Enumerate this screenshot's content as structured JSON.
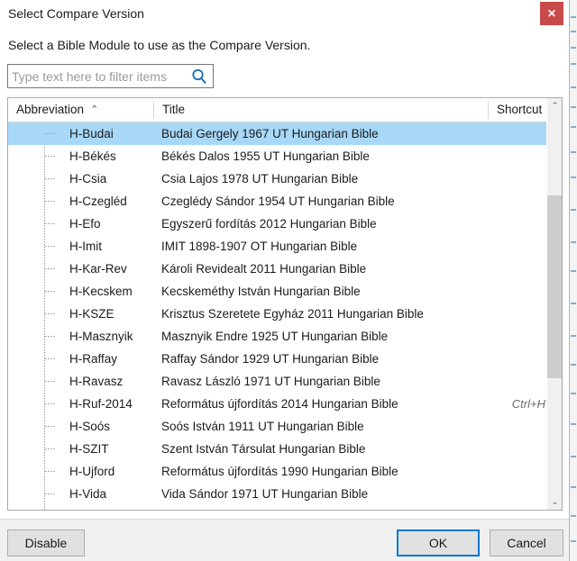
{
  "dialog": {
    "title": "Select Compare Version",
    "instruction": "Select a Bible Module to use as the Compare Version.",
    "close_label": "✕",
    "accent_close_color": "#c84a4a",
    "selection_color": "#a8d8f8",
    "focus_color": "#0078d7"
  },
  "filter": {
    "value": "",
    "placeholder": "Type text here to filter items",
    "icon": "search-icon"
  },
  "list": {
    "columns": [
      {
        "key": "abbreviation",
        "label": "Abbreviation",
        "sort": "ascending",
        "sort_caret": "⌃"
      },
      {
        "key": "title",
        "label": "Title",
        "sort": "none"
      },
      {
        "key": "shortcut",
        "label": "Shortcut",
        "sort": "none"
      }
    ],
    "rows": [
      {
        "abbreviation": "H-Budai",
        "title": "Budai Gergely 1967 UT Hungarian Bible",
        "shortcut": "",
        "selected": true
      },
      {
        "abbreviation": "H-Békés",
        "title": "Békés Dalos 1955 UT Hungarian Bible",
        "shortcut": "",
        "selected": false
      },
      {
        "abbreviation": "H-Csia",
        "title": "Csia Lajos 1978 UT Hungarian Bible",
        "shortcut": "",
        "selected": false
      },
      {
        "abbreviation": "H-Czegléd",
        "title": "Czeglédy Sándor 1954 UT Hungarian Bible",
        "shortcut": "",
        "selected": false
      },
      {
        "abbreviation": "H-Efo",
        "title": "Egyszerű fordítás 2012 Hungarian Bible",
        "shortcut": "",
        "selected": false
      },
      {
        "abbreviation": "H-Imit",
        "title": "IMIT 1898-1907 OT Hungarian Bible",
        "shortcut": "",
        "selected": false
      },
      {
        "abbreviation": "H-Kar-Rev",
        "title": "Károli Revidealt 2011 Hungarian Bible",
        "shortcut": "",
        "selected": false
      },
      {
        "abbreviation": "H-Kecskem",
        "title": "Kecskeméthy István Hungarian Bible",
        "shortcut": "",
        "selected": false
      },
      {
        "abbreviation": "H-KSZE",
        "title": "Krisztus Szeretete Egyház 2011 Hungarian Bible",
        "shortcut": "",
        "selected": false
      },
      {
        "abbreviation": "H-Masznyik",
        "title": "Masznyik Endre 1925 UT Hungarian Bible",
        "shortcut": "",
        "selected": false
      },
      {
        "abbreviation": "H-Raffay",
        "title": "Raffay Sándor 1929 UT Hungarian Bible",
        "shortcut": "",
        "selected": false
      },
      {
        "abbreviation": "H-Ravasz",
        "title": "Ravasz László 1971 UT Hungarian Bible",
        "shortcut": "",
        "selected": false
      },
      {
        "abbreviation": "H-Ruf-2014",
        "title": "Református újfordítás 2014 Hungarian Bible",
        "shortcut": "Ctrl+H",
        "selected": false
      },
      {
        "abbreviation": "H-Soós",
        "title": "Soós István 1911 UT Hungarian Bible",
        "shortcut": "",
        "selected": false
      },
      {
        "abbreviation": "H-SZIT",
        "title": "Szent István Társulat Hungarian Bible",
        "shortcut": "",
        "selected": false
      },
      {
        "abbreviation": "H-Ujford",
        "title": "Református újfordítás 1990 Hungarian Bible",
        "shortcut": "",
        "selected": false
      },
      {
        "abbreviation": "H-Vida",
        "title": "Vida Sándor 1971 UT Hungarian Bible",
        "shortcut": "",
        "selected": false
      }
    ]
  },
  "scrollbar": {
    "up_arrow": "⌃",
    "down_arrow": "⌄"
  },
  "footer": {
    "disable_label": "Disable",
    "ok_label": "OK",
    "cancel_label": "Cancel"
  }
}
